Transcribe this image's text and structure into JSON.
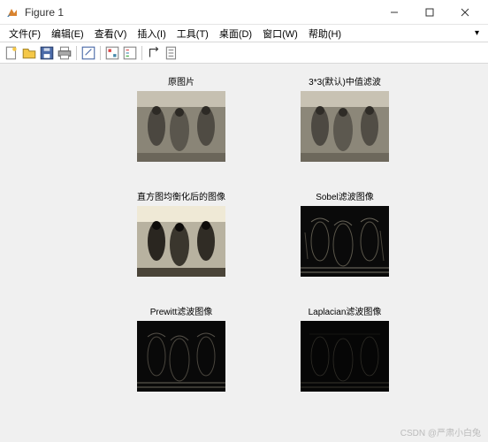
{
  "window": {
    "title": "Figure 1"
  },
  "menu": {
    "file": "文件(F)",
    "edit": "编辑(E)",
    "view": "查看(V)",
    "insert": "插入(I)",
    "tools": "工具(T)",
    "desktop": "桌面(D)",
    "window": "窗口(W)",
    "help": "帮助(H)",
    "tail": "▾"
  },
  "toolbar_icons": {
    "new": "new-figure-icon",
    "open": "open-icon",
    "save": "save-icon",
    "print": "print-icon",
    "edit_plot": "edit-plot-icon",
    "link": "link-icon",
    "insert_legend": "insert-legend-icon",
    "rotate": "rotate-icon",
    "open_property": "open-property-icon"
  },
  "subplots": {
    "p1": {
      "title": "原图片"
    },
    "p2": {
      "title": "3*3(默认)中值滤波"
    },
    "p3": {
      "title": "直方图均衡化后的图像"
    },
    "p4": {
      "title": "Sobel滤波图像"
    },
    "p5": {
      "title": "Prewitt滤波图像"
    },
    "p6": {
      "title": "Laplacian滤波图像"
    }
  },
  "watermark": "CSDN @严肃小白兔"
}
